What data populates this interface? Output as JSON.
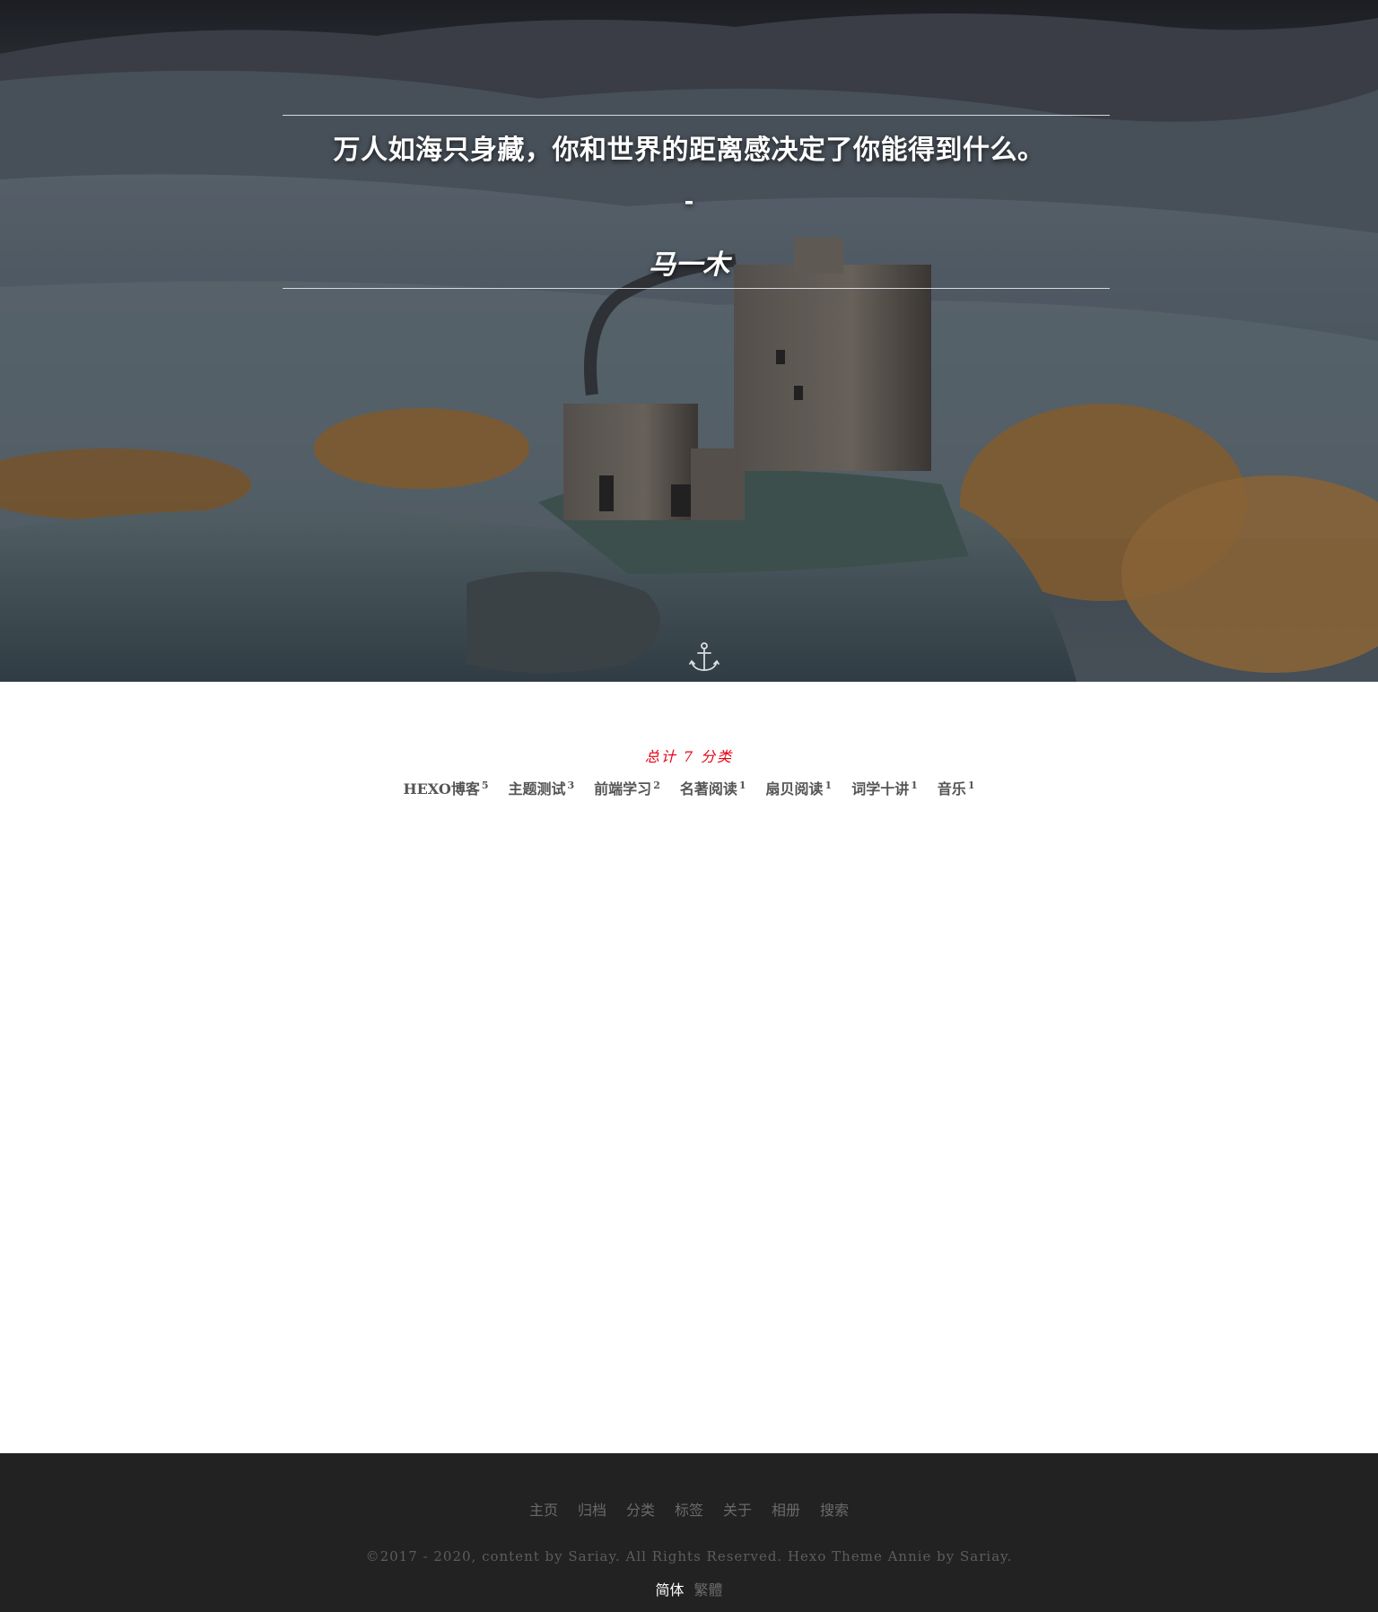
{
  "hero": {
    "quote": "万人如海只身藏，你和世界的距离感决定了你能得到什么。",
    "dash": "-",
    "author": "马一木",
    "anchor_icon": "anchor-icon"
  },
  "categories": {
    "total_label": "总计 7 分类",
    "items": [
      {
        "name": "HEXO博客",
        "count": "5"
      },
      {
        "name": "主题测试",
        "count": "3"
      },
      {
        "name": "前端学习",
        "count": "2"
      },
      {
        "name": "名著阅读",
        "count": "1"
      },
      {
        "name": "扇贝阅读",
        "count": "1"
      },
      {
        "name": "词学十讲",
        "count": "1"
      },
      {
        "name": "音乐",
        "count": "1"
      }
    ],
    "accent_color": "#e60012"
  },
  "footer": {
    "nav": [
      "主页",
      "归档",
      "分类",
      "标签",
      "关于",
      "相册",
      "搜索"
    ],
    "copyright": "©2017 - 2020, content by Sariay. All Rights Reserved. Hexo Theme Annie by Sariay.",
    "lang_active": "简体",
    "lang_inactive": "繁體",
    "background": "#222222"
  }
}
